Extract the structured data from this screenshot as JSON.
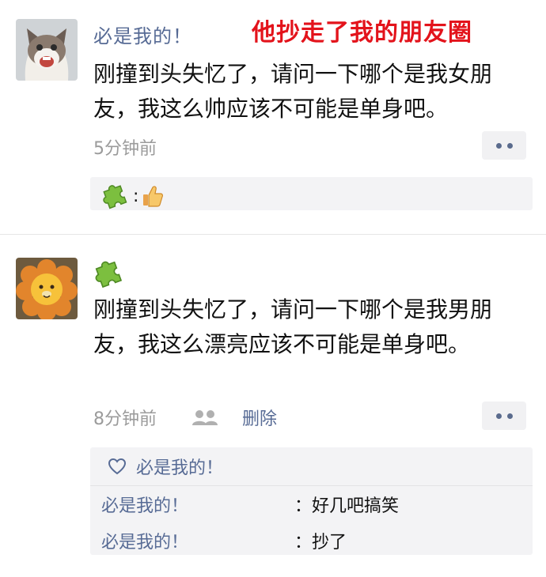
{
  "overlay_title": "他抄走了我的朋友圈",
  "post1": {
    "author": "必是我的！",
    "content": "刚撞到头失忆了，请问一下哪个是我女朋友，我这么帅应该不可能是单身吧。",
    "time": "5分钟前",
    "like_colon": ":"
  },
  "post2": {
    "content": "刚撞到头失忆了，请问一下哪个是我男朋友，我这么漂亮应该不可能是单身吧。",
    "time": "8分钟前",
    "delete_label": "删除",
    "likes_name": "必是我的！",
    "comments": [
      {
        "name": "必是我的！",
        "text": "：好几吧搞笑"
      },
      {
        "name": "必是我的！",
        "text": "：抄了"
      }
    ]
  },
  "icons": {
    "avatar1": "cat-avatar-icon",
    "avatar2": "lion-plush-avatar-icon",
    "puzzle": "puzzle-icon",
    "thumb": "thumbs-up-icon",
    "friends": "friends-icon",
    "heart": "heart-icon",
    "more": "more-dots-icon"
  },
  "colors": {
    "link": "#576b95",
    "overlay": "#e3131b",
    "panel": "#f3f3f5"
  }
}
